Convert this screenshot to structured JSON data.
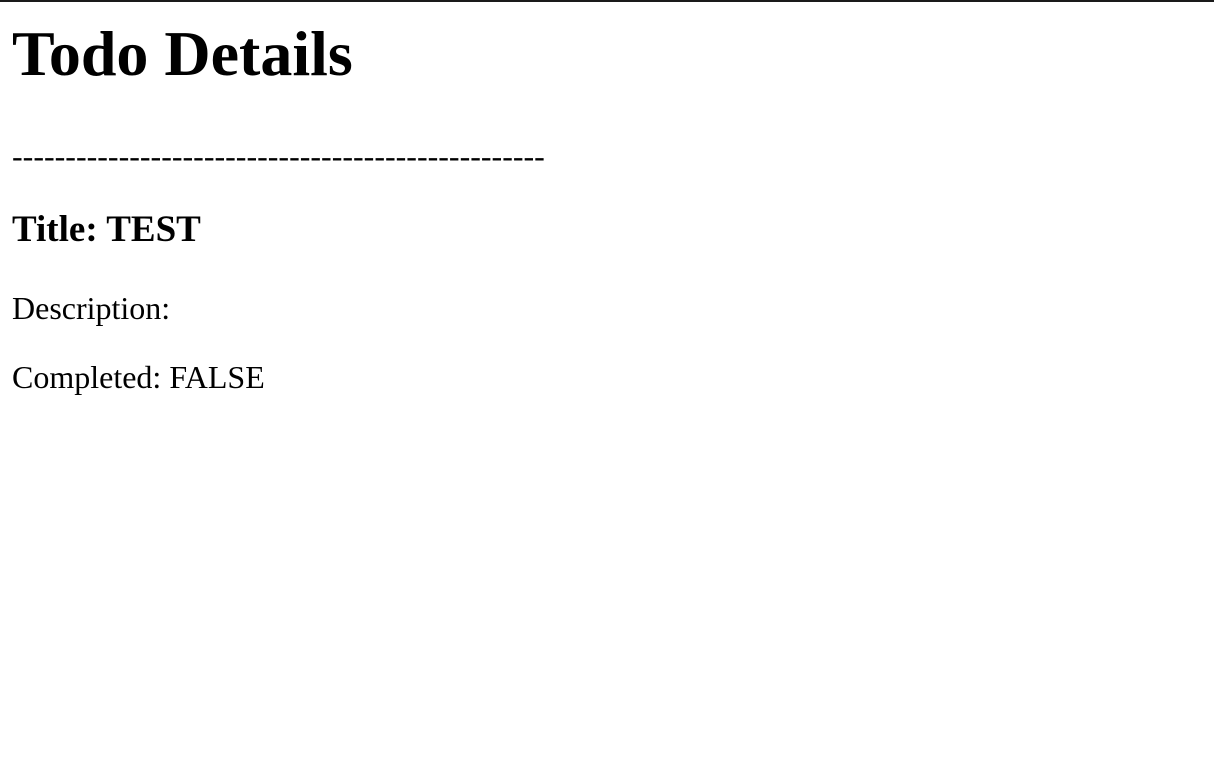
{
  "page": {
    "heading": "Todo Details",
    "separator": "--------------------------------------------------"
  },
  "todo": {
    "title_label": "Title:",
    "title_value": "TEST",
    "description_label": "Description:",
    "description_value": "",
    "completed_label": "Completed:",
    "completed_value": "FALSE"
  }
}
